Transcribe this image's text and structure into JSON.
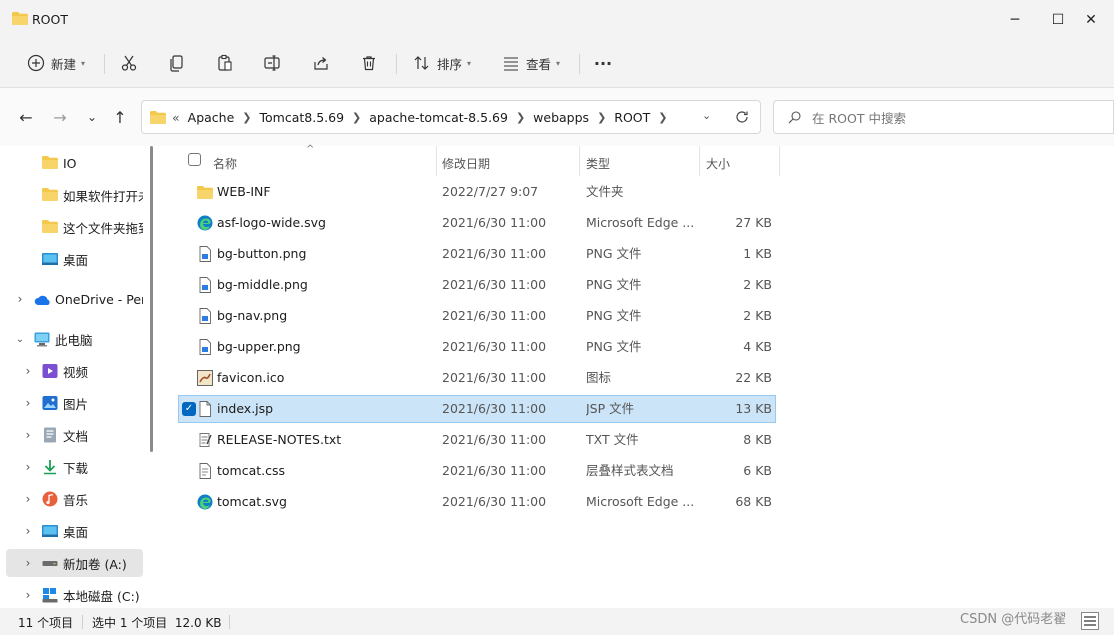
{
  "window": {
    "title": "ROOT",
    "minimize_glyph": "─",
    "maximize_glyph": "☐",
    "close_glyph": "✕"
  },
  "toolbar": {
    "new_label": "新建",
    "sort_label": "排序",
    "view_label": "查看",
    "more_label": "···"
  },
  "nav": {
    "back": "←",
    "forward": "→",
    "recent": "⌄",
    "up": "↑"
  },
  "address": {
    "overflow": "«",
    "crumbs": [
      "Apache",
      "Tomcat8.5.69",
      "apache-tomcat-8.5.69",
      "webapps",
      "ROOT"
    ]
  },
  "search": {
    "placeholder": "在 ROOT 中搜索"
  },
  "sidebar": {
    "items": [
      {
        "label": "IO",
        "icon": "folder-icon"
      },
      {
        "label": "如果软件打开未",
        "icon": "folder-icon"
      },
      {
        "label": "这个文件夹拖到",
        "icon": "folder-icon"
      },
      {
        "label": "桌面",
        "icon": "desktop-icon"
      },
      {
        "label": "OneDrive - Pers",
        "icon": "onedrive-icon"
      },
      {
        "label": "此电脑",
        "icon": "computer-icon"
      },
      {
        "label": "视频",
        "icon": "video-icon"
      },
      {
        "label": "图片",
        "icon": "pictures-icon"
      },
      {
        "label": "文档",
        "icon": "documents-icon"
      },
      {
        "label": "下载",
        "icon": "download-icon"
      },
      {
        "label": "音乐",
        "icon": "music-icon"
      },
      {
        "label": "桌面",
        "icon": "desktop-icon"
      },
      {
        "label": "新加卷 (A:)",
        "icon": "drive-icon"
      },
      {
        "label": "本地磁盘 (C:)",
        "icon": "windows-drive-icon"
      }
    ]
  },
  "columns": {
    "name": "名称",
    "date": "修改日期",
    "type": "类型",
    "size": "大小"
  },
  "files": [
    {
      "name": "WEB-INF",
      "date": "2022/7/27 9:07",
      "type": "文件夹",
      "size": "",
      "icon": "folder-icon"
    },
    {
      "name": "asf-logo-wide.svg",
      "date": "2021/6/30 11:00",
      "type": "Microsoft Edge ...",
      "size": "27 KB",
      "icon": "edge-icon"
    },
    {
      "name": "bg-button.png",
      "date": "2021/6/30 11:00",
      "type": "PNG 文件",
      "size": "1 KB",
      "icon": "image-file-icon"
    },
    {
      "name": "bg-middle.png",
      "date": "2021/6/30 11:00",
      "type": "PNG 文件",
      "size": "2 KB",
      "icon": "image-file-icon"
    },
    {
      "name": "bg-nav.png",
      "date": "2021/6/30 11:00",
      "type": "PNG 文件",
      "size": "2 KB",
      "icon": "image-file-icon"
    },
    {
      "name": "bg-upper.png",
      "date": "2021/6/30 11:00",
      "type": "PNG 文件",
      "size": "4 KB",
      "icon": "image-file-icon"
    },
    {
      "name": "favicon.ico",
      "date": "2021/6/30 11:00",
      "type": "图标",
      "size": "22 KB",
      "icon": "favicon-icon"
    },
    {
      "name": "index.jsp",
      "date": "2021/6/30 11:00",
      "type": "JSP 文件",
      "size": "13 KB",
      "icon": "file-icon",
      "selected": true
    },
    {
      "name": "RELEASE-NOTES.txt",
      "date": "2021/6/30 11:00",
      "type": "TXT 文件",
      "size": "8 KB",
      "icon": "text-file-icon"
    },
    {
      "name": "tomcat.css",
      "date": "2021/6/30 11:00",
      "type": "层叠样式表文档",
      "size": "6 KB",
      "icon": "css-file-icon"
    },
    {
      "name": "tomcat.svg",
      "date": "2021/6/30 11:00",
      "type": "Microsoft Edge ...",
      "size": "68 KB",
      "icon": "edge-icon"
    }
  ],
  "status": {
    "count": "11 个项目",
    "selection": "选中 1 个项目  12.0 KB"
  },
  "watermark": "CSDN @代码老翟",
  "colors": {
    "folder": "#f2c94c",
    "selection": "#cce4f7",
    "accent": "#0067c0"
  }
}
